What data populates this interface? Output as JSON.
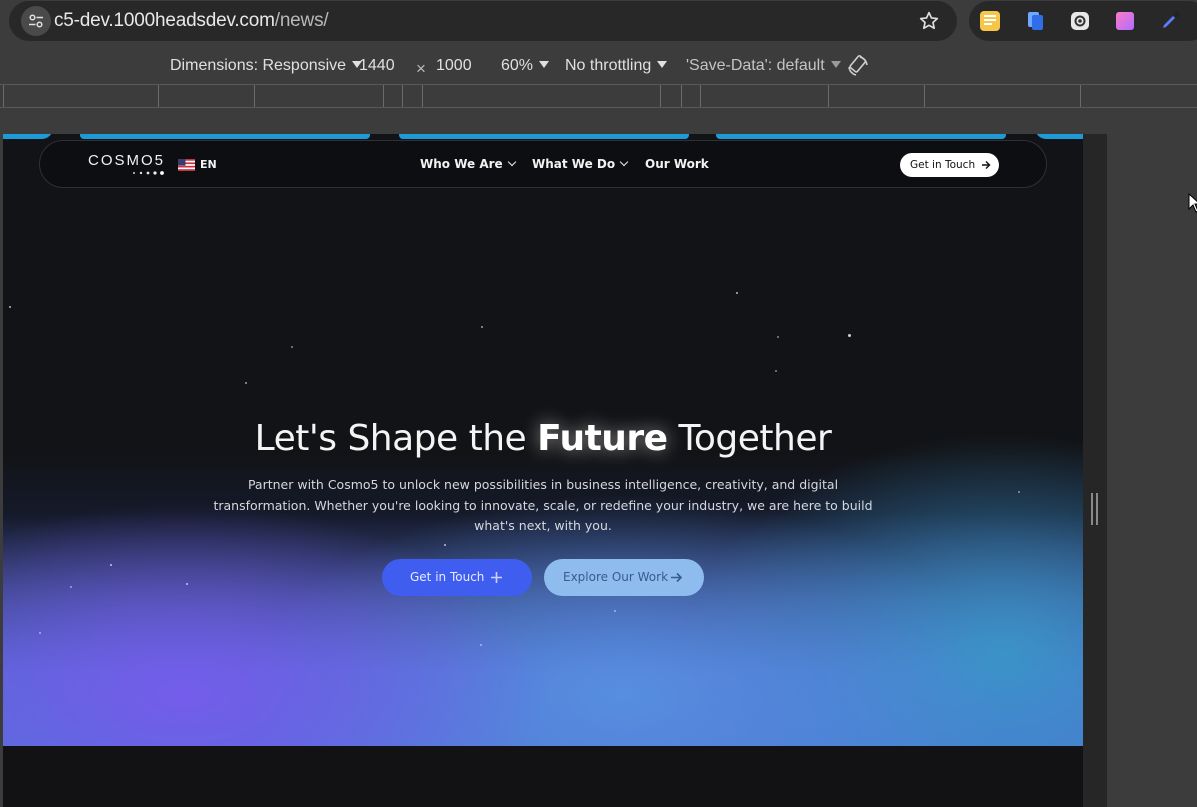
{
  "browser": {
    "url_host": "c5-dev.1000headsdev.com",
    "url_path": "/news/"
  },
  "devtools": {
    "dimensions_label": "Dimensions: Responsive",
    "width": "1440",
    "times": "×",
    "height": "1000",
    "zoom": "60%",
    "throttling": "No throttling",
    "save_data": "'Save-Data': default"
  },
  "site": {
    "logo": "COSMO5",
    "language": "EN",
    "nav": {
      "who_we_are": "Who We Are",
      "what_we_do": "What We Do",
      "our_work": "Our Work",
      "cta": "Get in Touch"
    },
    "hero": {
      "title_before": "Let's Shape the ",
      "title_bold": "Future",
      "title_after": " Together",
      "subtitle": "Partner with Cosmo5 to unlock new possibilities in business intelligence, creativity, and digital transformation. Whether you're looking to innovate, scale, or redefine your industry, we are here to build what's next, with you.",
      "primary_button": "Get in Touch",
      "secondary_button": "Explore Our Work"
    }
  },
  "colors": {
    "accent_blue": "#3f5ef0",
    "secondary_button": "#8fbcef",
    "page_dark": "#111214"
  }
}
